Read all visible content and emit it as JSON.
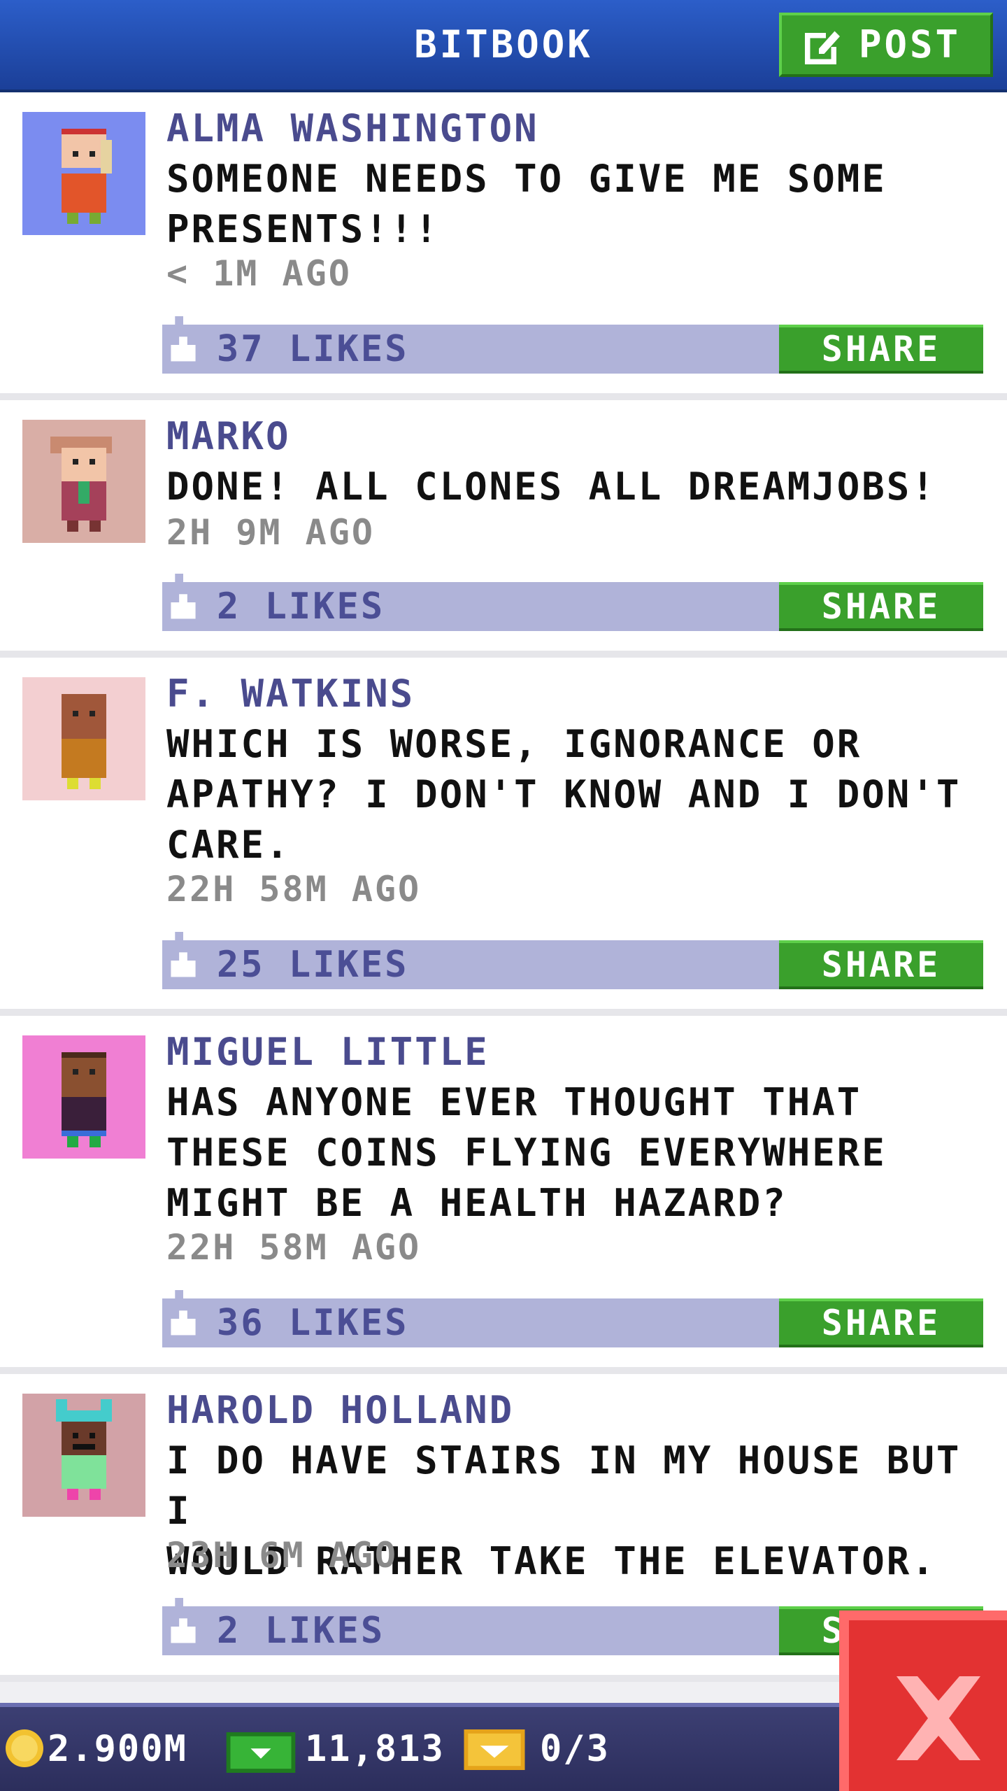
{
  "header": {
    "title": "BITBOOK",
    "post_label": "POST"
  },
  "posts": [
    {
      "name": "ALMA WASHINGTON",
      "text": "SOMEONE NEEDS TO GIVE ME SOME\nPRESENTS!!!",
      "time": "< 1M AGO",
      "likes": "37 LIKES",
      "share": "SHARE",
      "avatar_bg": "#7b8cf0"
    },
    {
      "name": "MARKO",
      "text": "DONE! ALL CLONES ALL DREAMJOBS!",
      "time": "2H 9M AGO",
      "likes": "2 LIKES",
      "share": "SHARE",
      "avatar_bg": "#d9aea6"
    },
    {
      "name": "F. WATKINS",
      "text": "WHICH IS WORSE, IGNORANCE OR\nAPATHY? I DON'T KNOW AND I DON'T\nCARE.",
      "time": "22H 58M AGO",
      "likes": "25 LIKES",
      "share": "SHARE",
      "avatar_bg": "#f3cfd1"
    },
    {
      "name": "MIGUEL LITTLE",
      "text": "HAS ANYONE EVER THOUGHT THAT\nTHESE COINS FLYING EVERYWHERE\nMIGHT BE A HEALTH HAZARD?",
      "time": "22H 58M AGO",
      "likes": "36 LIKES",
      "share": "SHARE",
      "avatar_bg": "#f07fd3"
    },
    {
      "name": "HAROLD HOLLAND",
      "text": "I DO HAVE STAIRS IN MY HOUSE BUT I\nWOULD RATHER TAKE THE ELEVATOR.",
      "time": "23H 6M AGO",
      "likes": "2 LIKES",
      "share": "SHARE",
      "avatar_bg": "#d2a2a7"
    }
  ],
  "status": {
    "coins": "2.900M",
    "bux": "11,813",
    "tickets": "0/3"
  },
  "colors": {
    "accent_green": "#3aa02c",
    "header_blue": "#2c5ec9",
    "like_bar": "#b0b3d9",
    "close_red": "#e33232"
  }
}
